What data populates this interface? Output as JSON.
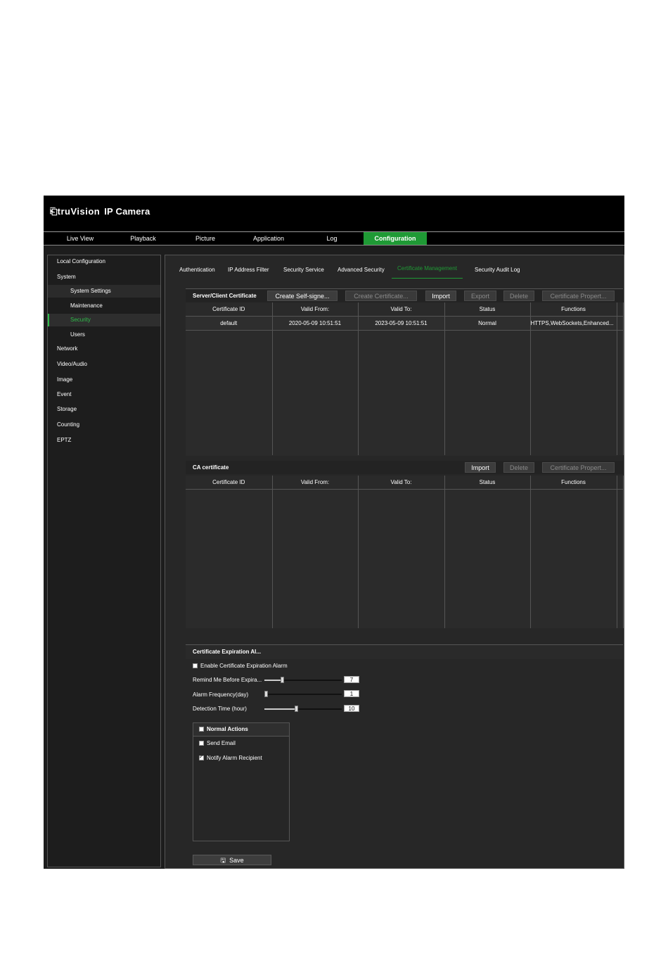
{
  "header": {
    "brand": "truVision",
    "product": "IP Camera"
  },
  "topnav": [
    "Live View",
    "Playback",
    "Picture",
    "Application",
    "Log",
    "Configuration"
  ],
  "sidebar": {
    "items": [
      "Local Configuration",
      "System",
      "System Settings",
      "Maintenance",
      "Security",
      "Users",
      "Network",
      "Video/Audio",
      "Image",
      "Event",
      "Storage",
      "Counting",
      "EPTZ"
    ]
  },
  "tabs": [
    "Authentication",
    "IP Address Filter",
    "Security Service",
    "Advanced Security",
    "Certificate Management",
    "Security Audit Log"
  ],
  "server_cert": {
    "title": "Server/Client Certificate",
    "buttons": [
      "Create Self-signe...",
      "Create Certificate...",
      "Import",
      "Export",
      "Delete",
      "Certificate Propert..."
    ],
    "columns": [
      "Certificate ID",
      "Valid From:",
      "Valid To:",
      "Status",
      "Functions"
    ],
    "rows": [
      [
        "default",
        "2020-05-09 10:51:51",
        "2023-05-09 10:51:51",
        "Normal",
        "HTTPS,WebSockets,Enhanced..."
      ]
    ]
  },
  "ca_cert": {
    "title": "CA certificate",
    "buttons": [
      "Import",
      "Delete",
      "Certificate Propert..."
    ],
    "columns": [
      "Certificate ID",
      "Valid From:",
      "Valid To:",
      "Status",
      "Functions"
    ]
  },
  "expiration": {
    "title": "Certificate Expiration Al...",
    "enable_label": "Enable Certificate Expiration Alarm",
    "remind_label": "Remind Me Before Expira...",
    "remind_value": "7",
    "freq_label": "Alarm Frequency(day)",
    "freq_value": "1",
    "detect_label": "Detection Time (hour)",
    "detect_value": "10",
    "normal_actions": "Normal Actions",
    "send_email": "Send Email",
    "notify": "Notify Alarm Recipient",
    "save": "Save"
  },
  "colors": {
    "accent": "#1f9a35",
    "background": "#1d1d1d"
  }
}
